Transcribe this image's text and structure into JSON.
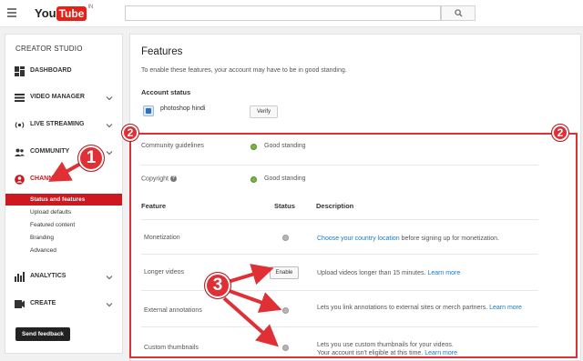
{
  "header": {
    "logo_you": "You",
    "logo_tube": "Tube",
    "logo_region": "IN",
    "search_placeholder": ""
  },
  "sidebar": {
    "title": "CREATOR STUDIO",
    "items": [
      {
        "label": "DASHBOARD",
        "icon": "dashboard-icon",
        "expandable": false
      },
      {
        "label": "VIDEO MANAGER",
        "icon": "video-manager-icon",
        "expandable": true
      },
      {
        "label": "LIVE STREAMING",
        "icon": "live-streaming-icon",
        "expandable": true
      },
      {
        "label": "COMMUNITY",
        "icon": "community-icon",
        "expandable": true
      },
      {
        "label": "CHANNEL",
        "icon": "channel-icon",
        "expandable": false,
        "active": true
      },
      {
        "label": "ANALYTICS",
        "icon": "analytics-icon",
        "expandable": true
      },
      {
        "label": "CREATE",
        "icon": "create-icon",
        "expandable": true
      }
    ],
    "sub_items": [
      {
        "label": "Status and features",
        "active": true
      },
      {
        "label": "Upload defaults"
      },
      {
        "label": "Featured content"
      },
      {
        "label": "Branding"
      },
      {
        "label": "Advanced"
      }
    ],
    "feedback_label": "Send feedback"
  },
  "main": {
    "title": "Features",
    "intro": "To enable these features, your account may have to be in good standing.",
    "account_status_title": "Account status",
    "account_name": "photoshop hindi",
    "verify_label": "Verify",
    "standing_rows": [
      {
        "label": "Community guidelines",
        "status": "Good standing",
        "status_color": "#7cb342"
      },
      {
        "label": "Copyright",
        "status": "Good standing",
        "status_color": "#7cb342"
      }
    ],
    "table_headers": {
      "feature": "Feature",
      "status": "Status",
      "description": "Description"
    },
    "features": [
      {
        "name": "Monetization",
        "status": "gray-dot",
        "desc_link": "Choose your country location",
        "desc_text": " before signing up for monetization."
      },
      {
        "name": "Longer videos",
        "status": "button",
        "button_label": "Enable",
        "desc_text": "Upload videos longer than 15 minutes. ",
        "desc_link": "Learn more"
      },
      {
        "name": "External annotations",
        "status": "gray-dot",
        "desc_text": "Lets you link annotations to external sites or merch partners. ",
        "desc_link": "Learn more"
      },
      {
        "name": "Custom thumbnails",
        "status": "gray-dot",
        "desc_line1": "Lets you use custom thumbnails for your videos.",
        "desc_line2": "Your account isn't eligible at this time. ",
        "desc_link": "Learn more"
      }
    ]
  },
  "annotations": {
    "badge_1": "1",
    "badge_2": "2",
    "badge_3": "3",
    "color": "#e02f35"
  }
}
